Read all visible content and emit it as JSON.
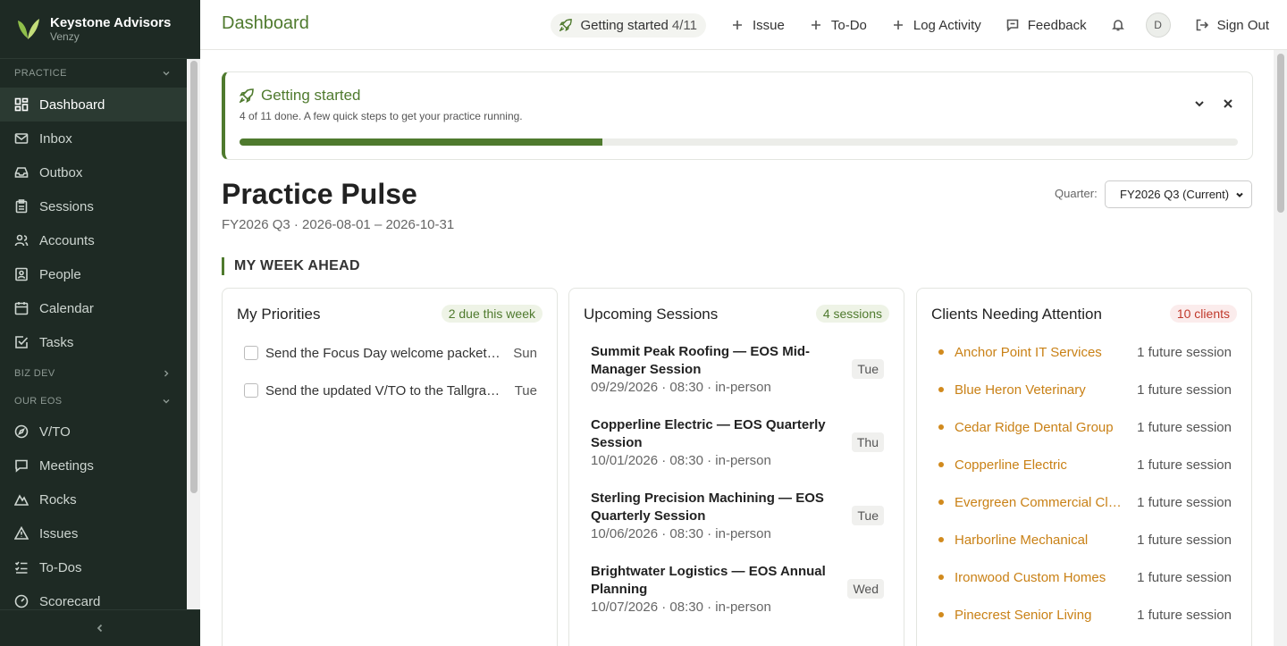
{
  "brand": {
    "name": "Keystone Advisors",
    "sub": "Venzy"
  },
  "sidebar": {
    "sections": {
      "practice": "PRACTICE",
      "bizdev": "BIZ DEV",
      "oureos": "OUR EOS"
    },
    "practice_items": [
      {
        "label": "Dashboard",
        "icon": "dashboard-icon"
      },
      {
        "label": "Inbox",
        "icon": "mail-icon"
      },
      {
        "label": "Outbox",
        "icon": "outbox-icon"
      },
      {
        "label": "Sessions",
        "icon": "clipboard-icon"
      },
      {
        "label": "Accounts",
        "icon": "users-icon"
      },
      {
        "label": "People",
        "icon": "contact-icon"
      },
      {
        "label": "Calendar",
        "icon": "calendar-icon"
      },
      {
        "label": "Tasks",
        "icon": "check-square-icon"
      }
    ],
    "eos_items": [
      {
        "label": "V/TO",
        "icon": "compass-icon"
      },
      {
        "label": "Meetings",
        "icon": "chat-icon"
      },
      {
        "label": "Rocks",
        "icon": "mountain-icon"
      },
      {
        "label": "Issues",
        "icon": "warning-icon"
      },
      {
        "label": "To-Dos",
        "icon": "list-icon"
      },
      {
        "label": "Scorecard",
        "icon": "gauge-icon"
      }
    ]
  },
  "header": {
    "title": "Dashboard",
    "getting_started": "Getting started",
    "getting_started_count": "4/11",
    "issue": "Issue",
    "todo": "To-Do",
    "log_activity": "Log Activity",
    "feedback": "Feedback",
    "avatar_initial": "D",
    "sign_out": "Sign Out"
  },
  "getting_started_card": {
    "title": "Getting started",
    "subtitle": "4 of 11 done. A few quick steps to get your practice running.",
    "progress": 0.3636
  },
  "pulse": {
    "title": "Practice Pulse",
    "subtitle": "FY2026 Q3 · 2026-08-01 – 2026-10-31",
    "quarter_label": "Quarter:",
    "quarter_value": "FY2026 Q3 (Current)"
  },
  "week": {
    "heading": "MY WEEK AHEAD"
  },
  "priorities": {
    "title": "My Priorities",
    "badge": "2 due this week",
    "items": [
      {
        "text": "Send the Focus Day welcome packet to the Summit Peak Roofing team",
        "day": "Sun"
      },
      {
        "text": "Send the updated V/TO to the Tallgrass Foods leadership team",
        "day": "Tue"
      }
    ]
  },
  "sessions": {
    "title": "Upcoming Sessions",
    "badge": "4 sessions",
    "items": [
      {
        "title": "Summit Peak Roofing — EOS Mid-Manager Session",
        "meta": "09/29/2026 · 08:30 · in-person",
        "day": "Tue"
      },
      {
        "title": "Copperline Electric — EOS Quarterly Session",
        "meta": "10/01/2026 · 08:30 · in-person",
        "day": "Thu"
      },
      {
        "title": "Sterling Precision Machining — EOS Quarterly Session",
        "meta": "10/06/2026 · 08:30 · in-person",
        "day": "Tue"
      },
      {
        "title": "Brightwater Logistics — EOS Annual Planning",
        "meta": "10/07/2026 · 08:30 · in-person",
        "day": "Wed"
      }
    ]
  },
  "clients": {
    "title": "Clients Needing Attention",
    "badge": "10 clients",
    "items": [
      {
        "name": "Anchor Point IT Services",
        "status": "1 future session"
      },
      {
        "name": "Blue Heron Veterinary",
        "status": "1 future session"
      },
      {
        "name": "Cedar Ridge Dental Group",
        "status": "1 future session"
      },
      {
        "name": "Copperline Electric",
        "status": "1 future session"
      },
      {
        "name": "Evergreen Commercial Cleaning",
        "status": "1 future session"
      },
      {
        "name": "Harborline Mechanical",
        "status": "1 future session"
      },
      {
        "name": "Ironwood Custom Homes",
        "status": "1 future session"
      },
      {
        "name": "Pinecrest Senior Living",
        "status": "1 future session"
      }
    ]
  },
  "colors": {
    "brand_green": "#4f7a2e",
    "sidebar_bg": "#1e2a24",
    "client_orange": "#c98116",
    "alert_red": "#c0392b"
  }
}
